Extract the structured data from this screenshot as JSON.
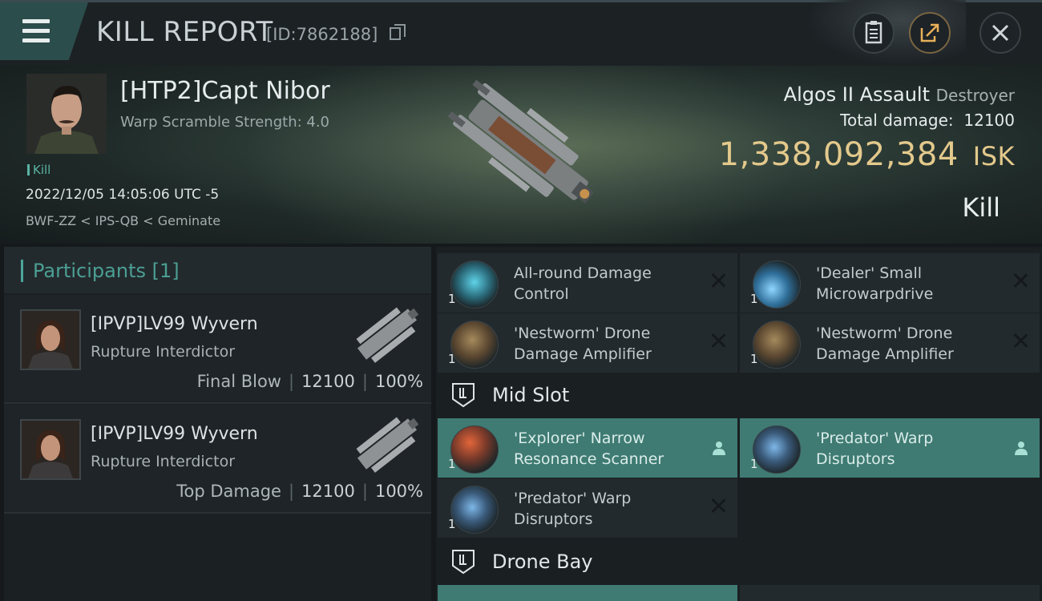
{
  "header": {
    "title": "KILL REPORT",
    "report_id": "[ID:7862188]"
  },
  "victim": {
    "name": "[HTP2]Capt Nibor",
    "warp_scramble": "Warp Scramble Strength: 4.0",
    "kill_tag": "Kill",
    "datetime": "2022/12/05 14:05:06 UTC -5",
    "location": "BWF-ZZ < IPS-QB < Geminate",
    "ship": "Algos II Assault",
    "ship_class": "Destroyer",
    "total_damage_label": "Total damage:",
    "total_damage": "12100",
    "isk_value": "1,338,092,384",
    "isk_unit": "ISK",
    "result": "Kill"
  },
  "participants": {
    "header": "Participants [1]",
    "rows": [
      {
        "name": "[IPVP]LV99 Wyvern",
        "ship": "Rupture Interdictor",
        "label": "Final Blow",
        "damage": "12100",
        "percent": "100%"
      },
      {
        "name": "[IPVP]LV99 Wyvern",
        "ship": "Rupture Interdictor",
        "label": "Top Damage",
        "damage": "12100",
        "percent": "100%"
      }
    ]
  },
  "fitting": {
    "low_slots": [
      {
        "qty": "1",
        "name": "All-round Damage Control",
        "icon": "damage-control-icon",
        "state": "destroyed"
      },
      {
        "qty": "1",
        "name": "'Dealer' Small Microwarpdrive",
        "icon": "microwarpdrive-icon",
        "state": "destroyed"
      },
      {
        "qty": "1",
        "name": "'Nestworm' Drone Damage Amplifier",
        "icon": "drone-amplifier-icon",
        "state": "destroyed"
      },
      {
        "qty": "1",
        "name": "'Nestworm' Drone Damage Amplifier",
        "icon": "drone-amplifier-icon",
        "state": "destroyed"
      }
    ],
    "mid_slot_title": "Mid Slot",
    "mid_slots": [
      {
        "qty": "1",
        "name": "'Explorer' Narrow Resonance Scanner",
        "icon": "scanner-icon",
        "state": "dropped"
      },
      {
        "qty": "1",
        "name": "'Predator' Warp Disruptors",
        "icon": "warp-disruptor-icon",
        "state": "dropped"
      },
      {
        "qty": "1",
        "name": "'Predator' Warp Disruptors",
        "icon": "warp-disruptor-icon",
        "state": "destroyed"
      }
    ],
    "drone_bay_title": "Drone Bay"
  },
  "colors": {
    "accent_teal": "#4aa79a",
    "highlight_slot": "#3f7b72",
    "isk_gold": "#e3c98c"
  }
}
